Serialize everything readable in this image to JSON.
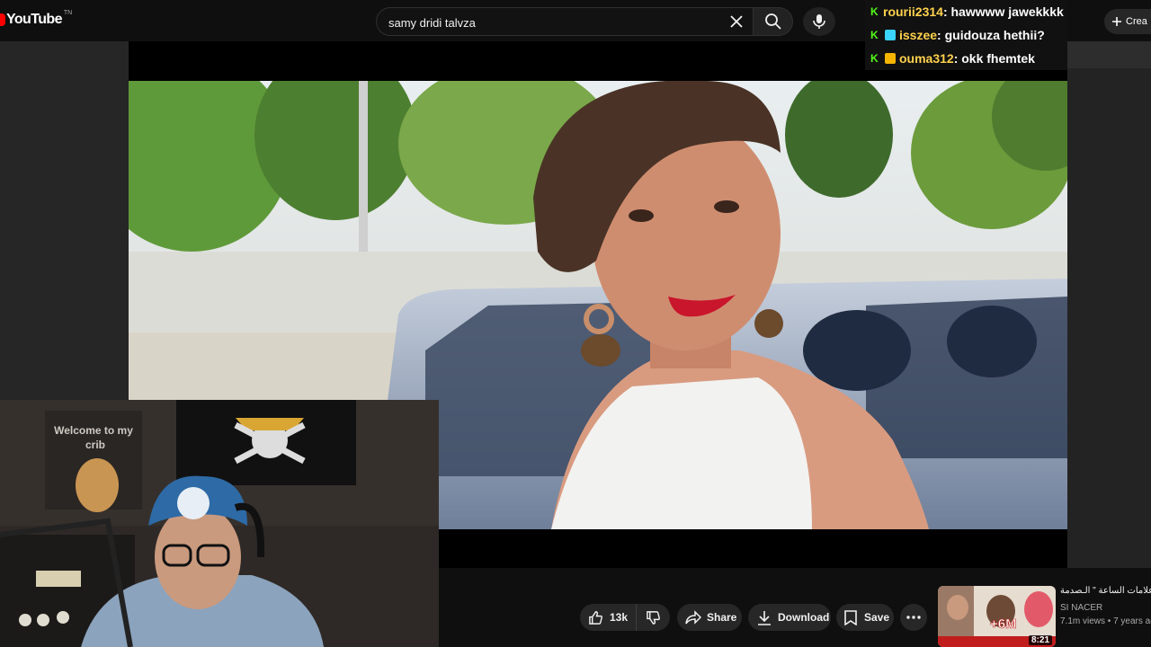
{
  "header": {
    "logo_text": "YouTube",
    "logo_region": "TN",
    "search_value": "samy dridi talvza",
    "create_label": "Crea"
  },
  "chat": {
    "messages": [
      {
        "user": "rourii2314",
        "text": " : hawwww jawekkkk",
        "badge_color": "#53fc18"
      },
      {
        "user": "isszee",
        "text": " : guidouza hethii?",
        "badge_color": "#3ad4ff"
      },
      {
        "user": "ouma312",
        "text": " : okk fhemtek",
        "badge_color": "#f5b400"
      }
    ]
  },
  "webcam": {
    "poster_text": "Welcome to my crib"
  },
  "actions": {
    "likes": "13k",
    "share": "Share",
    "download": "Download",
    "save": "Save"
  },
  "recommendation": {
    "title": "\" علامات الساعة \" الـصدمة",
    "channel": "SI NACER",
    "meta": "7.1m views • 7 years ago",
    "duration": "8:21",
    "thumb_badge": "+6M"
  },
  "colors": {
    "background": "#0f0f0f",
    "brand": "#ff0000",
    "chat_badge": "#53fc18",
    "chat_user": "#ffd24d"
  }
}
